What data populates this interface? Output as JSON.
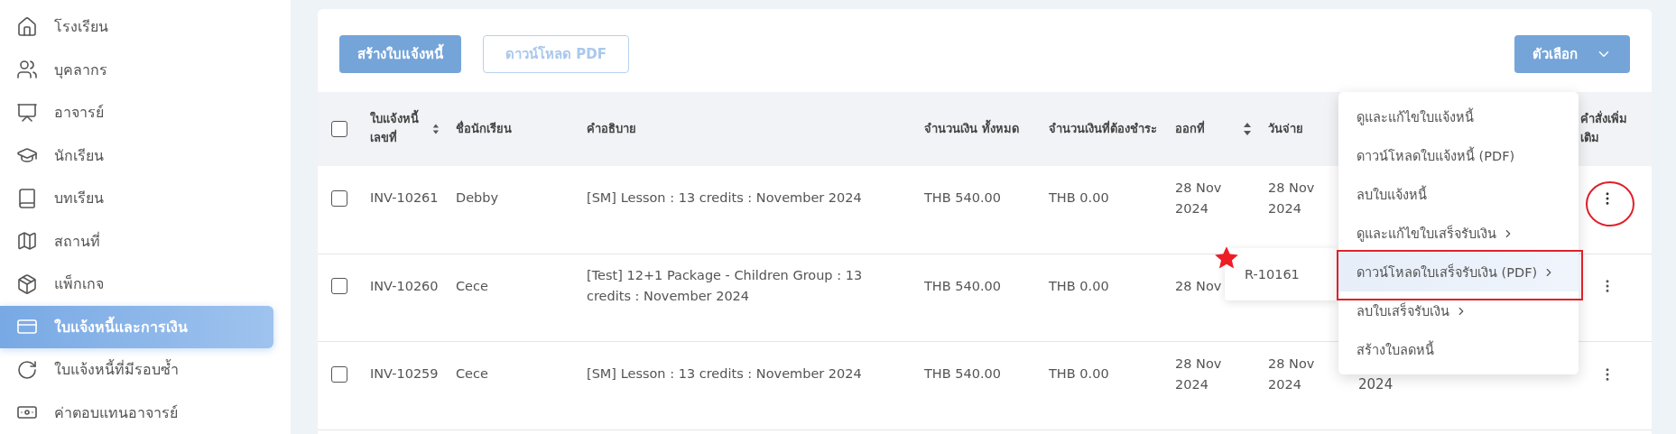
{
  "sidebar": {
    "items": [
      {
        "label": "โรงเรียน",
        "selected": false
      },
      {
        "label": "บุคลากร",
        "selected": false
      },
      {
        "label": "อาจารย์",
        "selected": false
      },
      {
        "label": "นักเรียน",
        "selected": false
      },
      {
        "label": "บทเรียน",
        "selected": false
      },
      {
        "label": "สถานที่",
        "selected": false
      },
      {
        "label": "แพ็กเกจ",
        "selected": false
      },
      {
        "label": "ใบแจ้งหนี้และการเงิน",
        "selected": true
      },
      {
        "label": "ใบแจ้งหนี้ที่มีรอบซ้ำ",
        "selected": false
      },
      {
        "label": "ค่าตอบแทนอาจารย์",
        "selected": false
      }
    ]
  },
  "toolbar": {
    "create_button": {
      "label": "สร้างใบแจ้งหนี้"
    },
    "download_button": {
      "label": "ดาวน์โหลด PDF",
      "disabled": true
    },
    "options_button": {
      "label": "ตัวเลือก"
    }
  },
  "table": {
    "select_all": {
      "checked": false
    },
    "columns": [
      {
        "label": "ใบแจ้งหนี้ เลขที่",
        "sortable": true
      },
      {
        "label": "ชื่อนักเรียน",
        "sortable": false
      },
      {
        "label": "คำอธิบาย",
        "sortable": false
      },
      {
        "label": "จำนวนเงิน ทั้งหมด",
        "sortable": false
      },
      {
        "label": "จำนวนเงินที่ต้องชำระ",
        "sortable": false
      },
      {
        "label": "ออกที่",
        "sortable": true
      },
      {
        "label": "วันจ่าย",
        "sortable": false
      },
      {
        "label": "คำสั่งเพิ่มเติม",
        "sortable": false
      }
    ],
    "rows": [
      {
        "checked": false,
        "invoice_no": "INV-10261",
        "student": "Debby",
        "description": "[SM] Lesson : 13 credits : November 2024",
        "total": "THB 540.00",
        "due": "THB 0.00",
        "issued": "28 Nov 2024",
        "pay_date": "28 Nov 2024",
        "menu_open": true
      },
      {
        "checked": false,
        "invoice_no": "INV-10260",
        "student": "Cece",
        "description": "[Test] 12+1 Package - Children Group : 13 credits : November 2024",
        "total": "THB 540.00",
        "due": "THB 0.00",
        "issued": "28 Nov",
        "menu_open": false
      },
      {
        "checked": false,
        "invoice_no": "INV-10259",
        "student": "Cece",
        "description": "[SM] Lesson : 13 credits : November 2024",
        "total": "THB 540.00",
        "due": "THB 0.00",
        "issued": "28 Nov 2024",
        "pay_date": "28 Nov 2024",
        "column_9": "2024",
        "menu_open": false
      }
    ]
  },
  "action_menu": {
    "items": [
      {
        "label": "ดูและแก้ไขใบแจ้งหนี้",
        "has_submenu": false,
        "selected": false
      },
      {
        "label": "ดาวน์โหลดใบแจ้งหนี้ (PDF)",
        "has_submenu": false,
        "selected": false
      },
      {
        "label": "ลบใบแจ้งหนี้",
        "has_submenu": false,
        "selected": false
      },
      {
        "label": "ดูและแก้ไขใบเสร็จรับเงิน",
        "has_submenu": true,
        "selected": false
      },
      {
        "label": "ดาวน์โหลดใบเสร็จรับเงิน (PDF)",
        "has_submenu": true,
        "selected": true
      },
      {
        "label": "ลบใบเสร็จรับเงิน",
        "has_submenu": true,
        "selected": false
      },
      {
        "label": "สร้างใบลดหนี้",
        "has_submenu": false,
        "selected": false
      }
    ]
  },
  "submenu": {
    "items": [
      {
        "label": "R-10161"
      }
    ]
  }
}
